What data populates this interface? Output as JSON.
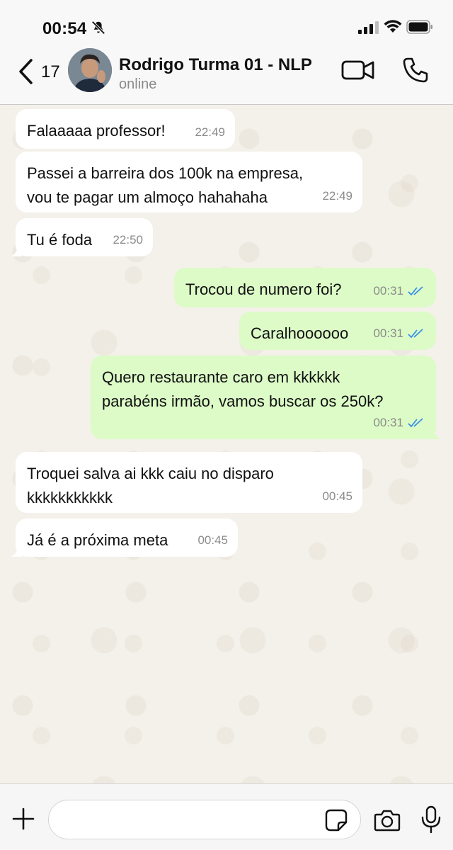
{
  "status_bar": {
    "time": "00:54"
  },
  "header": {
    "unread_count": "17",
    "contact_name": "Rodrigo Turma 01 - NLP",
    "contact_status": "online"
  },
  "messages": [
    {
      "direction": "in",
      "text": [
        "Falaaaaa professor!"
      ],
      "time": "22:49"
    },
    {
      "direction": "in",
      "text": [
        "Passei a barreira dos 100k na empresa,",
        "vou te pagar um almoço hahahaha"
      ],
      "time": "22:49"
    },
    {
      "direction": "in",
      "text": [
        "Tu é foda"
      ],
      "time": "22:50"
    },
    {
      "direction": "out",
      "text": [
        "Trocou de numero foi?"
      ],
      "time": "00:31",
      "status": "read"
    },
    {
      "direction": "out",
      "text": [
        "Caralhoooooo"
      ],
      "time": "00:31",
      "status": "read"
    },
    {
      "direction": "out",
      "text": [
        "Quero restaurante caro em kkkkkk",
        "parabéns irmão, vamos buscar os 250k?"
      ],
      "time": "00:31",
      "status": "read"
    },
    {
      "direction": "in",
      "text": [
        "Troquei salva ai kkk caiu no disparo",
        "kkkkkkkkkkk"
      ],
      "time": "00:45"
    },
    {
      "direction": "in",
      "text": [
        "Já é a próxima meta"
      ],
      "time": "00:45"
    }
  ],
  "composer": {
    "placeholder": ""
  },
  "colors": {
    "incoming_bubble": "#ffffff",
    "outgoing_bubble": "#dcfbc7",
    "read_ticks": "#3a8fe6",
    "chat_background": "#f4f1ea"
  },
  "icons": {
    "status": [
      "bell-slash-icon",
      "signal-icon",
      "wifi-icon",
      "battery-icon"
    ],
    "header": [
      "chevron-left-icon",
      "video-camera-icon",
      "phone-icon"
    ],
    "composer": [
      "plus-icon",
      "sticker-icon",
      "camera-icon",
      "microphone-icon"
    ]
  }
}
